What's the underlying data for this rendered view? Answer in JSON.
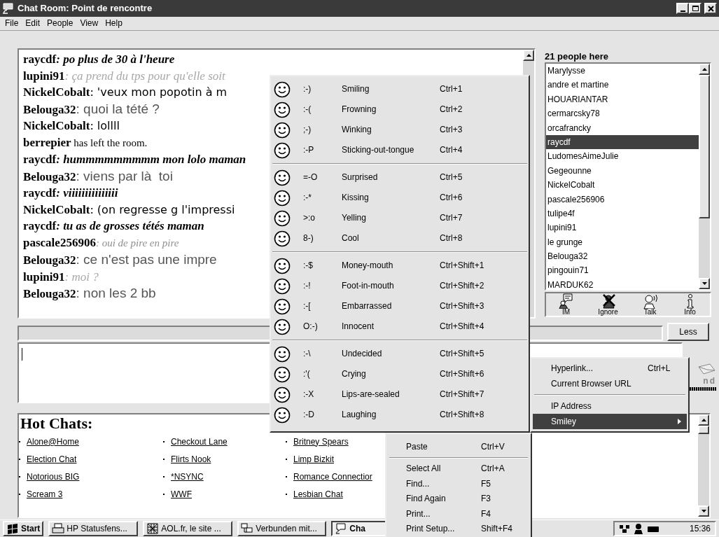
{
  "window": {
    "title": "Chat Room: Point de rencontre"
  },
  "menu_bar": [
    "File",
    "Edit",
    "People",
    "View",
    "Help"
  ],
  "chat": [
    {
      "name": "raycdf",
      "text": ": po plus de 30 à l'heure",
      "kind": "bolditalic"
    },
    {
      "name": "lupini91",
      "text": ": ça prend du tps pour qu'elle soit",
      "kind": "faint"
    },
    {
      "name": "NickelCobalt",
      "text": ": 'veux mon popotin à m",
      "kind": "script"
    },
    {
      "name": "Belouga32",
      "text": ": quoi la tété ?",
      "kind": "sans"
    },
    {
      "name": "NickelCobalt",
      "text": ": lollll",
      "kind": "script"
    },
    {
      "name": "berrepier",
      "text": " has left the room.",
      "kind": "notice"
    },
    {
      "name": "raycdf",
      "text": ": hummmmmmmmm mon lolo maman",
      "kind": "bolditalic"
    },
    {
      "name": "Belouga32",
      "text": ": viens par là  toi",
      "kind": "sans"
    },
    {
      "name": "raycdf",
      "text": ": viiiiiiiiiiiiiii",
      "kind": "bolditalic"
    },
    {
      "name": "NickelCobalt",
      "text": ": (on regresse g l'impressi",
      "kind": "script"
    },
    {
      "name": "raycdf",
      "text": ": tu as de grosses tétés maman",
      "kind": "bolditalic"
    },
    {
      "name": "pascale256906",
      "text": ": oui de pire en pire",
      "kind": "pale"
    },
    {
      "name": "Belouga32",
      "text": ": ce n'est pas une impre",
      "kind": "sans"
    },
    {
      "name": "lupini91",
      "text": ": moi ?",
      "kind": "faint"
    },
    {
      "name": "Belouga32",
      "text": ": non les 2 bb",
      "kind": "sans"
    }
  ],
  "people": {
    "count_label": "21 people here",
    "items": [
      {
        "name": "Marylysse",
        "selected": false
      },
      {
        "name": "andre et martine",
        "selected": false
      },
      {
        "name": "HOUARIANTAR",
        "selected": false
      },
      {
        "name": "cermarcsky78",
        "selected": false
      },
      {
        "name": "orcafrancky",
        "selected": false
      },
      {
        "name": "raycdf",
        "selected": true
      },
      {
        "name": "LudomesAimeJulie",
        "selected": false
      },
      {
        "name": "Gegeounne",
        "selected": false
      },
      {
        "name": "NickelCobalt",
        "selected": false
      },
      {
        "name": "pascale256906",
        "selected": false
      },
      {
        "name": "tulipe4f",
        "selected": false
      },
      {
        "name": "lupini91",
        "selected": false
      },
      {
        "name": "le grunge",
        "selected": false
      },
      {
        "name": "Belouga32",
        "selected": false
      },
      {
        "name": "pingouin71",
        "selected": false
      },
      {
        "name": "MARDUK62",
        "selected": false
      }
    ]
  },
  "people_buttons": [
    "IM",
    "Ignore",
    "Talk",
    "Info"
  ],
  "less_button": "Less",
  "send_button": "nd",
  "hot_chats": {
    "title": "Hot Chats:",
    "rows": [
      [
        "Alone@Home",
        "Checkout Lane",
        "Britney Spears"
      ],
      [
        "Election Chat",
        "Flirts Nook",
        "Limp Bizkit"
      ],
      [
        "Notorious BIG",
        "*NSYNC",
        "Romance Connectior"
      ],
      [
        "Scream 3",
        "WWF",
        "Lesbian Chat"
      ]
    ]
  },
  "taskbar": {
    "start": "Start",
    "items": [
      {
        "label": "HP Statusfens...",
        "selected": false
      },
      {
        "label": "AOL.fr, le site ...",
        "selected": false
      },
      {
        "label": "Verbunden mit...",
        "selected": false
      },
      {
        "label": "Cha",
        "selected": true
      }
    ],
    "clock": "15:36"
  },
  "smiley_menu": [
    [
      {
        "code": ":-)",
        "label": "Smiling",
        "shortcut": "Ctrl+1"
      },
      {
        "code": ":-(",
        "label": "Frowning",
        "shortcut": "Ctrl+2"
      },
      {
        "code": ";-)",
        "label": "Winking",
        "shortcut": "Ctrl+3"
      },
      {
        "code": ":-P",
        "label": "Sticking-out-tongue",
        "shortcut": "Ctrl+4"
      }
    ],
    [
      {
        "code": "=-O",
        "label": "Surprised",
        "shortcut": "Ctrl+5"
      },
      {
        "code": ":-*",
        "label": "Kissing",
        "shortcut": "Ctrl+6"
      },
      {
        "code": ">:o",
        "label": "Yelling",
        "shortcut": "Ctrl+7"
      },
      {
        "code": "8-)",
        "label": "Cool",
        "shortcut": "Ctrl+8"
      }
    ],
    [
      {
        "code": ":-$",
        "label": "Money-mouth",
        "shortcut": "Ctrl+Shift+1"
      },
      {
        "code": ":-!",
        "label": "Foot-in-mouth",
        "shortcut": "Ctrl+Shift+2"
      },
      {
        "code": ":-[",
        "label": "Embarrassed",
        "shortcut": "Ctrl+Shift+3"
      },
      {
        "code": "O:-)",
        "label": "Innocent",
        "shortcut": "Ctrl+Shift+4"
      }
    ],
    [
      {
        "code": ":-\\",
        "label": "Undecided",
        "shortcut": "Ctrl+Shift+5"
      },
      {
        "code": ":'(",
        "label": "Crying",
        "shortcut": "Ctrl+Shift+6"
      },
      {
        "code": ":-X",
        "label": "Lips-are-sealed",
        "shortcut": "Ctrl+Shift+7"
      },
      {
        "code": ":-D",
        "label": "Laughing",
        "shortcut": "Ctrl+Shift+8"
      }
    ]
  ],
  "insert_menu": [
    [
      {
        "label": "Hyperlink...",
        "shortcut": "Ctrl+L",
        "selected": false,
        "submenu": false
      },
      {
        "label": "Current Browser URL",
        "selected": false,
        "submenu": false
      }
    ],
    [
      {
        "label": "IP Address",
        "selected": false,
        "submenu": false
      },
      {
        "label": "Smiley",
        "selected": true,
        "submenu": true
      }
    ]
  ],
  "edit_menu": [
    [
      {
        "label": "Paste",
        "shortcut": "Ctrl+V"
      }
    ],
    [
      {
        "label": "Select All",
        "shortcut": "Ctrl+A"
      },
      {
        "label": "Find...",
        "shortcut": "F5"
      },
      {
        "label": "Find Again",
        "shortcut": "F3"
      },
      {
        "label": "Print...",
        "shortcut": "F4"
      },
      {
        "label": "Print Setup...",
        "shortcut": "Shift+F4"
      }
    ]
  ]
}
